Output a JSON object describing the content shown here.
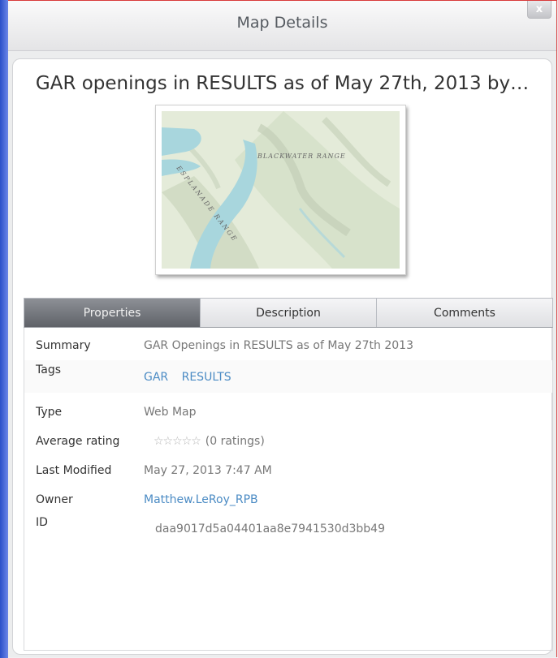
{
  "dialog": {
    "title": "Map Details",
    "close_label": "x"
  },
  "item": {
    "title": "GAR openings in RESULTS as of May 27th, 2013 by…",
    "thumbnail": {
      "labels": [
        "BLACKWATER RANGE",
        "ESPLANADE RANGE"
      ],
      "colors": {
        "land": "#e4ebd9",
        "water": "#a8d6dd",
        "relief": "#c7d2bc"
      }
    }
  },
  "tabs": [
    {
      "label": "Properties",
      "active": true
    },
    {
      "label": "Description",
      "active": false
    },
    {
      "label": "Comments",
      "active": false
    }
  ],
  "properties": {
    "summary": {
      "label": "Summary",
      "value": "GAR Openings in RESULTS as of May 27th 2013"
    },
    "tags": {
      "label": "Tags",
      "values": [
        "GAR",
        "RESULTS"
      ]
    },
    "type": {
      "label": "Type",
      "value": "Web Map"
    },
    "rating": {
      "label": "Average rating",
      "stars": "☆☆☆☆☆",
      "stars_filled": 0,
      "stars_total": 5,
      "count_text": "(0 ratings)"
    },
    "modified": {
      "label": "Last Modified",
      "value": "May 27, 2013 7:47 AM"
    },
    "owner": {
      "label": "Owner",
      "value": "Matthew.LeRoy_RPB"
    },
    "id": {
      "label": "ID",
      "value": "daa9017d5a04401aa8e7941530d3bb49"
    }
  },
  "colors": {
    "link": "#4b8bc4",
    "active_tab": "#6f7278",
    "accent_border": "#d83a3a",
    "window_strip": "#2a4fc8"
  }
}
